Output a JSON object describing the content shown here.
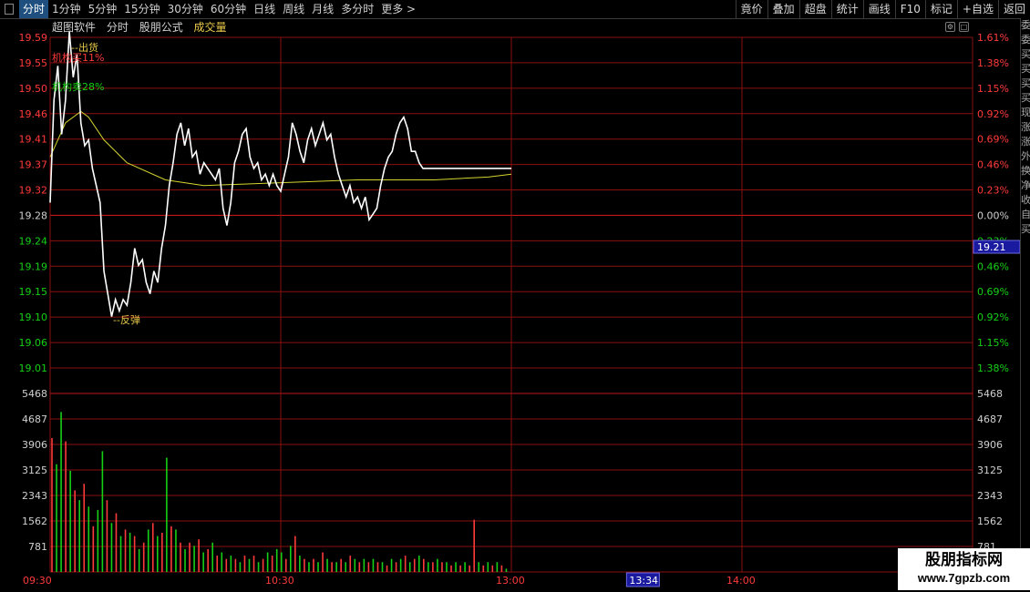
{
  "toolbar": {
    "timeframes": [
      {
        "label": "分时",
        "active": true
      },
      {
        "label": "1分钟",
        "active": false
      },
      {
        "label": "5分钟",
        "active": false
      },
      {
        "label": "15分钟",
        "active": false
      },
      {
        "label": "30分钟",
        "active": false
      },
      {
        "label": "60分钟",
        "active": false
      },
      {
        "label": "日线",
        "active": false
      },
      {
        "label": "周线",
        "active": false
      },
      {
        "label": "月线",
        "active": false
      },
      {
        "label": "多分时",
        "active": false
      },
      {
        "label": "更多 >",
        "active": false
      }
    ],
    "right_buttons": [
      "竟价",
      "叠加",
      "超盘",
      "统计",
      "画线",
      "F10",
      "标记",
      "+自选",
      "返回"
    ]
  },
  "chart_header": {
    "software": "超图软件",
    "mode": "分时",
    "formula": "股朋公式",
    "volume_label": "成交量"
  },
  "annotations": {
    "sell": "--出货",
    "buy_pct": "机构买11%",
    "sell_pct": "机构卖28%",
    "rebound": "--反弹"
  },
  "current_price_tag": "19.21",
  "cursor_time": "13:34",
  "watermark": {
    "line1": "股朋指标网",
    "line2": "www.7gpzb.com"
  },
  "side_panel_chars": [
    "委",
    "委",
    "买",
    "买",
    "买",
    "买",
    "现",
    "涨",
    "涨",
    "外",
    "换",
    "净",
    "收",
    "自",
    "买"
  ],
  "colors": {
    "up": "#ff3a3a",
    "down": "#16d016",
    "grid": "#8a1010",
    "price": "#ffffff",
    "avg": "#d4d430",
    "axis_neutral": "#d0d0d0"
  },
  "chart_data": {
    "type": "line",
    "price_axis": {
      "left_labels": [
        "19.59",
        "19.55",
        "19.50",
        "19.46",
        "19.41",
        "19.37",
        "19.32",
        "19.28",
        "19.24",
        "19.19",
        "19.15",
        "19.10",
        "19.06",
        "19.01"
      ],
      "right_labels": [
        "1.61%",
        "1.38%",
        "1.15%",
        "0.92%",
        "0.69%",
        "0.46%",
        "0.23%",
        "0.00%",
        "0.23%",
        "0.46%",
        "0.69%",
        "0.92%",
        "1.15%",
        "1.38%"
      ],
      "reference": 19.28,
      "ylim": [
        19.01,
        19.59
      ]
    },
    "volume_axis": {
      "labels": [
        "5468",
        "4687",
        "3906",
        "3125",
        "2343",
        "1562",
        "781"
      ],
      "ylim": [
        0,
        5468
      ]
    },
    "time_axis": {
      "labels": [
        "09:30",
        "10:30",
        "13:00",
        "14:00"
      ],
      "total_minutes": 240
    },
    "price": {
      "x": [
        0,
        1,
        2,
        3,
        4,
        5,
        6,
        7,
        8,
        9,
        10,
        11,
        12,
        13,
        14,
        15,
        16,
        17,
        18,
        19,
        20,
        21,
        22,
        23,
        24,
        25,
        26,
        27,
        28,
        29,
        30,
        31,
        32,
        33,
        34,
        35,
        36,
        37,
        38,
        39,
        40,
        41,
        42,
        43,
        44,
        45,
        46,
        47,
        48,
        49,
        50,
        51,
        52,
        53,
        54,
        55,
        56,
        57,
        58,
        59,
        60,
        61,
        62,
        63,
        64,
        65,
        66,
        67,
        68,
        69,
        70,
        71,
        72,
        73,
        74,
        75,
        76,
        77,
        78,
        79,
        80,
        81,
        82,
        83,
        84,
        85,
        86,
        87,
        88,
        89,
        90,
        91,
        92,
        93,
        94,
        95,
        96,
        97,
        98,
        99,
        100,
        101,
        102,
        103,
        104,
        105,
        106,
        107,
        108,
        109,
        110,
        111,
        112,
        113,
        114,
        115,
        116,
        117,
        118,
        119,
        120,
        121,
        122,
        123,
        124,
        125,
        126,
        127,
        128,
        129,
        130,
        131,
        132,
        133,
        134,
        135,
        136,
        137,
        138,
        139,
        140,
        141,
        142,
        143,
        144,
        145,
        146,
        147,
        148,
        149,
        150
      ],
      "y": [
        19.3,
        19.48,
        19.54,
        19.42,
        19.48,
        19.6,
        19.52,
        19.56,
        19.44,
        19.4,
        19.41,
        19.36,
        19.33,
        19.3,
        19.18,
        19.14,
        19.1,
        19.13,
        19.11,
        19.13,
        19.12,
        19.16,
        19.22,
        19.19,
        19.2,
        19.16,
        19.14,
        19.18,
        19.16,
        19.22,
        19.26,
        19.33,
        19.37,
        19.42,
        19.44,
        19.4,
        19.43,
        19.38,
        19.39,
        19.35,
        19.37,
        19.36,
        19.35,
        19.34,
        19.36,
        19.29,
        19.26,
        19.3,
        19.37,
        19.39,
        19.42,
        19.43,
        19.38,
        19.36,
        19.37,
        19.34,
        19.35,
        19.33,
        19.35,
        19.33,
        19.32,
        19.35,
        19.38,
        19.44,
        19.42,
        19.39,
        19.37,
        19.41,
        19.43,
        19.4,
        19.42,
        19.44,
        19.41,
        19.42,
        19.38,
        19.35,
        19.33,
        19.31,
        19.33,
        19.3,
        19.31,
        19.29,
        19.31,
        19.27,
        19.28,
        19.29,
        19.33,
        19.36,
        19.38,
        19.39,
        19.42,
        19.44,
        19.45,
        19.43,
        19.39,
        19.39,
        19.37,
        19.36,
        19.36,
        19.36,
        19.36,
        19.36,
        19.36,
        19.36,
        19.36,
        19.36,
        19.36,
        19.36,
        19.36,
        19.36,
        19.36,
        19.36,
        19.36,
        19.36,
        19.36,
        19.36,
        19.36,
        19.36,
        19.36,
        19.36,
        19.36,
        19.36,
        19.36,
        19.36,
        19.36,
        19.36,
        19.36,
        19.36,
        19.36,
        19.36,
        19.36,
        19.36,
        19.36,
        19.36,
        19.36,
        19.36,
        19.36,
        19.36,
        19.36,
        19.36,
        19.36,
        19.36,
        19.36,
        19.36,
        19.36,
        19.36,
        19.36,
        19.36,
        19.36
      ]
    },
    "avg": {
      "x": [
        0,
        4,
        8,
        10,
        14,
        20,
        30,
        40,
        60,
        80,
        100,
        114,
        120
      ],
      "y": [
        19.38,
        19.44,
        19.46,
        19.45,
        19.41,
        19.37,
        19.34,
        19.33,
        19.335,
        19.34,
        19.34,
        19.345,
        19.35
      ]
    },
    "volume": {
      "values": [
        4100,
        3300,
        4900,
        4000,
        3100,
        2500,
        2200,
        2700,
        2000,
        1400,
        1900,
        3700,
        2200,
        1500,
        1800,
        1100,
        1300,
        1200,
        1100,
        700,
        900,
        1300,
        1500,
        1100,
        1200,
        3500,
        1400,
        1300,
        900,
        700,
        900,
        800,
        1000,
        600,
        700,
        900,
        500,
        600,
        400,
        500,
        400,
        300,
        500,
        400,
        500,
        300,
        400,
        600,
        500,
        700,
        600,
        400,
        800,
        1100,
        500,
        400,
        300,
        400,
        300,
        600,
        400,
        300,
        300,
        400,
        300,
        500,
        400,
        300,
        400,
        300,
        400,
        300,
        300,
        200,
        400,
        300,
        400,
        500,
        300,
        400,
        500,
        400,
        300,
        300,
        400,
        300,
        300,
        200,
        300,
        200,
        300,
        200,
        1600,
        300,
        200,
        300,
        200,
        300,
        200,
        100
      ],
      "colors": [
        "up",
        "down",
        "down",
        "up",
        "down",
        "up",
        "down",
        "up",
        "down",
        "up",
        "down",
        "down",
        "up",
        "down",
        "up",
        "down",
        "up",
        "down",
        "up",
        "down",
        "up",
        "down",
        "up",
        "down",
        "up",
        "down",
        "up",
        "down",
        "up",
        "down",
        "up",
        "down",
        "up",
        "down",
        "up",
        "down",
        "up",
        "down",
        "up",
        "down",
        "up",
        "down",
        "up",
        "down",
        "up",
        "down",
        "up",
        "down",
        "up",
        "down",
        "down",
        "up",
        "down",
        "up",
        "down",
        "up",
        "down",
        "up",
        "down",
        "up",
        "down",
        "up",
        "down",
        "up",
        "down",
        "up",
        "down",
        "up",
        "down",
        "up",
        "down",
        "up",
        "down",
        "up",
        "down",
        "up",
        "down",
        "up",
        "down",
        "up",
        "down",
        "up",
        "down",
        "up",
        "down",
        "up",
        "down",
        "up",
        "down",
        "up",
        "down",
        "up",
        "up",
        "down",
        "up",
        "down",
        "up",
        "down",
        "up",
        "down"
      ]
    }
  }
}
